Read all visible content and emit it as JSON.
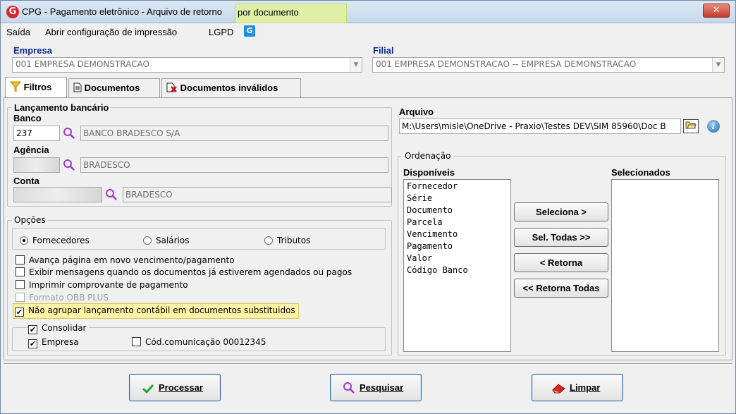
{
  "window": {
    "title": "CPG - Pagamento eletrônico - Arquivo de retorno",
    "title_highlight": "por documento",
    "close_label": "✕"
  },
  "menu": {
    "saida": "Saída",
    "abrir_config": "Abrir configuração de impressão",
    "lgpd": "LGPD"
  },
  "empresa": {
    "label": "Empresa",
    "value": "001 EMPRESA DEMONSTRACAO"
  },
  "filial": {
    "label": "Filial",
    "value": "001 EMPRESA DEMONSTRACAO -- EMPRESA DEMONSTRACAO"
  },
  "tabs": [
    {
      "label": "Filtros",
      "icon": "filter-icon"
    },
    {
      "label": "Documentos",
      "icon": "document-icon"
    },
    {
      "label": "Documentos inválidos",
      "icon": "invalid-document-icon"
    }
  ],
  "lancamento": {
    "title": "Lançamento bancário",
    "banco_label": "Banco",
    "banco_code": "237",
    "banco_name": "BANCO BRADESCO S/A",
    "agencia_label": "Agência",
    "agencia_name": "BRADESCO",
    "conta_label": "Conta",
    "conta_name": "BRADESCO"
  },
  "opcoes": {
    "title": "Opções",
    "radios": [
      "Fornecedores",
      "Salários",
      "Tributos"
    ],
    "selected_radio": "Fornecedores",
    "checkboxes": [
      {
        "label": "Avança página em novo vencimento/pagamento",
        "checked": false,
        "disabled": false
      },
      {
        "label": "Exibir mensagens quando os documentos já estiverem agendados ou pagos",
        "checked": false,
        "disabled": false
      },
      {
        "label": "Imprimir comprovante de pagamento",
        "checked": false,
        "disabled": false
      },
      {
        "label": "Formato OBB PLUS",
        "checked": false,
        "disabled": true
      },
      {
        "label": "Não agrupar lançamento contábil em documentos substituidos",
        "checked": true,
        "disabled": false
      }
    ],
    "consolidar": {
      "label": "Consolidar",
      "checked": true
    },
    "empresa": {
      "label": "Empresa",
      "checked": true
    },
    "cod_comunicacao": {
      "label": "Cód.comunicação 00012345",
      "checked": false
    }
  },
  "arquivo": {
    "label": "Arquivo",
    "value": "M:\\Users\\misle\\OneDrive - Praxio\\Testes DEV\\SIM 85960\\Doc B"
  },
  "ordenacao": {
    "title": "Ordenação",
    "disponiveis_label": "Disponíveis",
    "selecionados_label": "Selecionados",
    "disponiveis": [
      "Fornecedor",
      "Série",
      "Documento",
      "Parcela",
      "Vencimento",
      "Pagamento",
      "Valor",
      "Código Banco"
    ],
    "selecionados": [],
    "buttons": {
      "seleciona": "Seleciona >",
      "sel_todas": "Sel. Todas >>",
      "retorna": "< Retorna",
      "retorna_todas": "<< Retorna Todas"
    }
  },
  "actions": {
    "processar": "Processar",
    "pesquisar": "Pesquisar",
    "limpar": "Limpar"
  },
  "colors": {
    "label_blue": "#0d2b8a",
    "highlight_yellow": "#fef2a7",
    "check_green": "#2aa52a"
  }
}
